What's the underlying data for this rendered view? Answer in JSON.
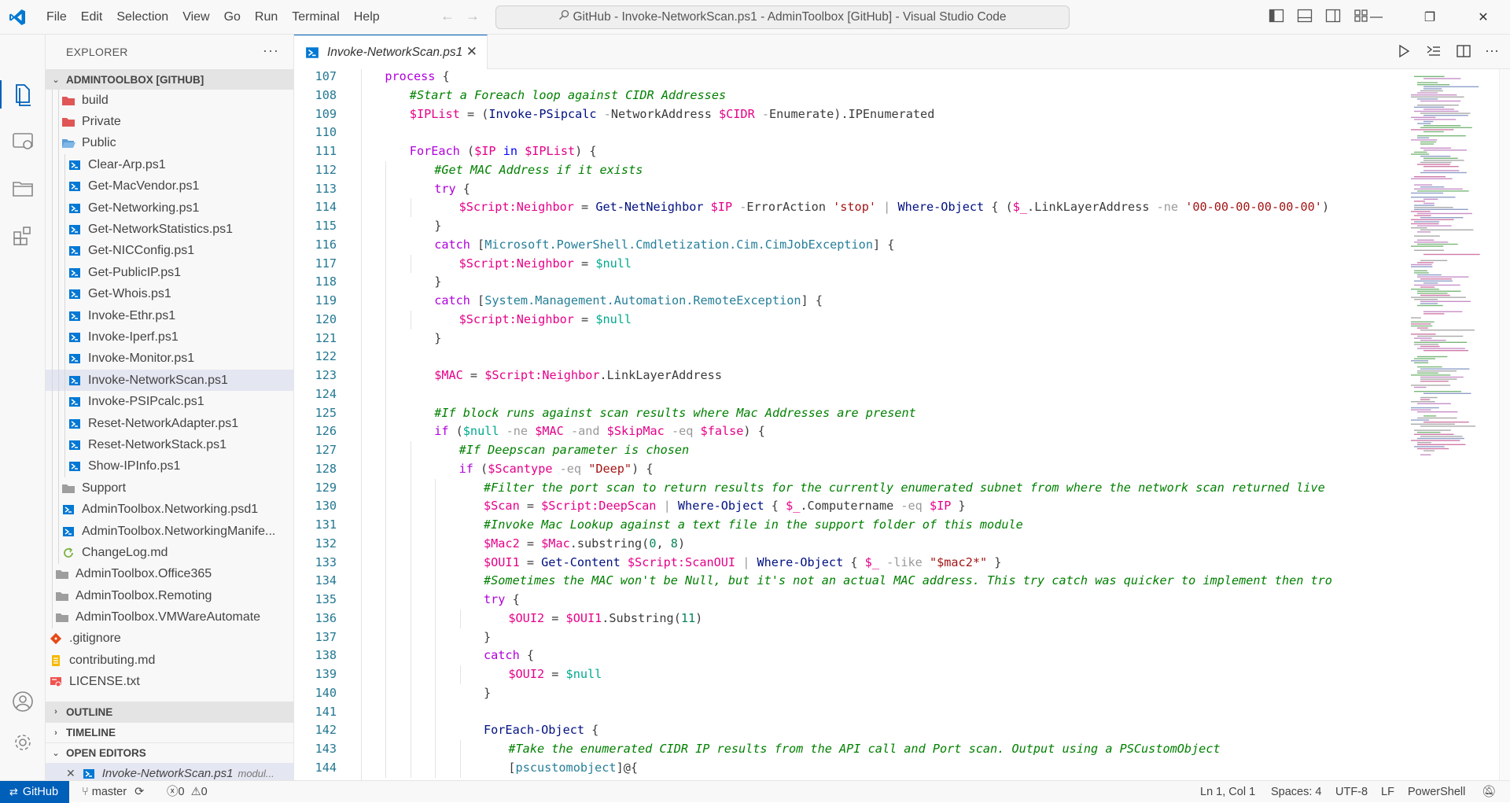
{
  "window": {
    "title": "GitHub - Invoke-NetworkScan.ps1 - AdminToolbox [GitHub] - Visual Studio Code",
    "menu": [
      "File",
      "Edit",
      "Selection",
      "View",
      "Go",
      "Run",
      "Terminal",
      "Help"
    ]
  },
  "sidebar": {
    "header": "EXPLORER",
    "root": "ADMINTOOLBOX [GITHUB]",
    "tree": [
      {
        "label": "build",
        "kind": "folder-red",
        "depth": 3
      },
      {
        "label": "Private",
        "kind": "folder-red",
        "depth": 3
      },
      {
        "label": "Public",
        "kind": "folder-open-blue",
        "depth": 3
      },
      {
        "label": "Clear-Arp.ps1",
        "kind": "ps1",
        "depth": 4
      },
      {
        "label": "Get-MacVendor.ps1",
        "kind": "ps1",
        "depth": 4
      },
      {
        "label": "Get-Networking.ps1",
        "kind": "ps1",
        "depth": 4
      },
      {
        "label": "Get-NetworkStatistics.ps1",
        "kind": "ps1",
        "depth": 4
      },
      {
        "label": "Get-NICConfig.ps1",
        "kind": "ps1",
        "depth": 4
      },
      {
        "label": "Get-PublicIP.ps1",
        "kind": "ps1",
        "depth": 4
      },
      {
        "label": "Get-Whois.ps1",
        "kind": "ps1",
        "depth": 4
      },
      {
        "label": "Invoke-Ethr.ps1",
        "kind": "ps1",
        "depth": 4
      },
      {
        "label": "Invoke-Iperf.ps1",
        "kind": "ps1",
        "depth": 4
      },
      {
        "label": "Invoke-Monitor.ps1",
        "kind": "ps1",
        "depth": 4
      },
      {
        "label": "Invoke-NetworkScan.ps1",
        "kind": "ps1",
        "depth": 4,
        "selected": true
      },
      {
        "label": "Invoke-PSIPcalc.ps1",
        "kind": "ps1",
        "depth": 4
      },
      {
        "label": "Reset-NetworkAdapter.ps1",
        "kind": "ps1",
        "depth": 4
      },
      {
        "label": "Reset-NetworkStack.ps1",
        "kind": "ps1",
        "depth": 4
      },
      {
        "label": "Show-IPInfo.ps1",
        "kind": "ps1",
        "depth": 4
      },
      {
        "label": "Support",
        "kind": "folder-gray",
        "depth": 3
      },
      {
        "label": "AdminToolbox.Networking.psd1",
        "kind": "ps1",
        "depth": 3
      },
      {
        "label": "AdminToolbox.NetworkingManife...",
        "kind": "ps1",
        "depth": 3
      },
      {
        "label": "ChangeLog.md",
        "kind": "md-loop",
        "depth": 3
      },
      {
        "label": "AdminToolbox.Office365",
        "kind": "folder-gray",
        "depth": 2
      },
      {
        "label": "AdminToolbox.Remoting",
        "kind": "folder-gray",
        "depth": 2
      },
      {
        "label": "AdminToolbox.VMWareAutomate",
        "kind": "folder-gray",
        "depth": 2
      },
      {
        "label": ".gitignore",
        "kind": "git",
        "depth": 1
      },
      {
        "label": "contributing.md",
        "kind": "md",
        "depth": 1
      },
      {
        "label": "LICENSE.txt",
        "kind": "license",
        "depth": 1
      }
    ],
    "sections": {
      "outline": "OUTLINE",
      "timeline": "TIMELINE",
      "open_editors": "OPEN EDITORS"
    },
    "open_editor": {
      "name": "Invoke-NetworkScan.ps1",
      "path": "modul..."
    }
  },
  "tab": {
    "label": "Invoke-NetworkScan.ps1"
  },
  "editor": {
    "lines": [
      {
        "n": "107",
        "i": 1,
        "t": [
          [
            "kw",
            "process"
          ],
          [
            "pr",
            " {"
          ]
        ]
      },
      {
        "n": "108",
        "i": 2,
        "t": [
          [
            "cm",
            "#Start a Foreach loop against CIDR Addresses"
          ]
        ]
      },
      {
        "n": "109",
        "i": 2,
        "t": [
          [
            "var",
            "$IPList"
          ],
          [
            "pr",
            " = ("
          ],
          [
            "fn",
            "Invoke-PSipcalc"
          ],
          [
            "op",
            " -"
          ],
          [
            "pr",
            "NetworkAddress "
          ],
          [
            "var",
            "$CIDR"
          ],
          [
            "op",
            " -"
          ],
          [
            "pr",
            "Enumerate)."
          ],
          [
            "pr",
            "IPEnumerated"
          ]
        ]
      },
      {
        "n": "110",
        "i": 0,
        "t": []
      },
      {
        "n": "111",
        "i": 2,
        "t": [
          [
            "kw",
            "ForEach"
          ],
          [
            "pr",
            " ("
          ],
          [
            "var",
            "$IP"
          ],
          [
            "kw2",
            " in "
          ],
          [
            "var",
            "$IPList"
          ],
          [
            "pr",
            ") {"
          ]
        ]
      },
      {
        "n": "112",
        "i": 3,
        "t": [
          [
            "cm",
            "#Get MAC Address if it exists"
          ]
        ]
      },
      {
        "n": "113",
        "i": 3,
        "t": [
          [
            "kw",
            "try"
          ],
          [
            "pr",
            " {"
          ]
        ]
      },
      {
        "n": "114",
        "i": 4,
        "t": [
          [
            "var",
            "$Script:Neighbor"
          ],
          [
            "pr",
            " = "
          ],
          [
            "fn",
            "Get-NetNeighbor"
          ],
          [
            "pr",
            " "
          ],
          [
            "var",
            "$IP"
          ],
          [
            "op",
            " -"
          ],
          [
            "pr",
            "ErrorAction "
          ],
          [
            "str",
            "'stop'"
          ],
          [
            "op",
            " | "
          ],
          [
            "fn",
            "Where-Object"
          ],
          [
            "pr",
            " { ("
          ],
          [
            "var",
            "$_"
          ],
          [
            "pr",
            ".LinkLayerAddress "
          ],
          [
            "op",
            "-ne "
          ],
          [
            "str",
            "'00-00-00-00-00-00'"
          ],
          [
            "pr",
            ")"
          ]
        ]
      },
      {
        "n": "115",
        "i": 3,
        "t": [
          [
            "pr",
            "}"
          ]
        ]
      },
      {
        "n": "116",
        "i": 3,
        "t": [
          [
            "kw",
            "catch"
          ],
          [
            "pr",
            " ["
          ],
          [
            "type",
            "Microsoft.PowerShell.Cmdletization.Cim.CimJobException"
          ],
          [
            "pr",
            "] {"
          ]
        ]
      },
      {
        "n": "117",
        "i": 4,
        "t": [
          [
            "var",
            "$Script:Neighbor"
          ],
          [
            "pr",
            " = "
          ],
          [
            "nul",
            "$null"
          ]
        ]
      },
      {
        "n": "118",
        "i": 3,
        "t": [
          [
            "pr",
            "}"
          ]
        ]
      },
      {
        "n": "119",
        "i": 3,
        "t": [
          [
            "kw",
            "catch"
          ],
          [
            "pr",
            " ["
          ],
          [
            "type",
            "System.Management.Automation.RemoteException"
          ],
          [
            "pr",
            "] {"
          ]
        ]
      },
      {
        "n": "120",
        "i": 4,
        "t": [
          [
            "var",
            "$Script:Neighbor"
          ],
          [
            "pr",
            " = "
          ],
          [
            "nul",
            "$null"
          ]
        ]
      },
      {
        "n": "121",
        "i": 3,
        "t": [
          [
            "pr",
            "}"
          ]
        ]
      },
      {
        "n": "122",
        "i": 0,
        "t": []
      },
      {
        "n": "123",
        "i": 3,
        "t": [
          [
            "var",
            "$MAC"
          ],
          [
            "pr",
            " = "
          ],
          [
            "var",
            "$Script:Neighbor"
          ],
          [
            "pr",
            ".LinkLayerAddress"
          ]
        ]
      },
      {
        "n": "124",
        "i": 0,
        "t": []
      },
      {
        "n": "125",
        "i": 3,
        "t": [
          [
            "cm",
            "#If block runs against scan results where Mac Addresses are present"
          ]
        ]
      },
      {
        "n": "126",
        "i": 3,
        "t": [
          [
            "kw",
            "if"
          ],
          [
            "pr",
            " ("
          ],
          [
            "nul",
            "$null"
          ],
          [
            "op",
            " -ne "
          ],
          [
            "var",
            "$MAC"
          ],
          [
            "op",
            " -and "
          ],
          [
            "var",
            "$SkipMac"
          ],
          [
            "op",
            " -eq "
          ],
          [
            "var",
            "$false"
          ],
          [
            "pr",
            ") {"
          ]
        ]
      },
      {
        "n": "127",
        "i": 4,
        "t": [
          [
            "cm",
            "#If Deepscan parameter is chosen"
          ]
        ]
      },
      {
        "n": "128",
        "i": 4,
        "t": [
          [
            "kw",
            "if"
          ],
          [
            "pr",
            " ("
          ],
          [
            "var",
            "$Scantype"
          ],
          [
            "op",
            " -eq "
          ],
          [
            "str",
            "\"Deep\""
          ],
          [
            "pr",
            ") {"
          ]
        ]
      },
      {
        "n": "129",
        "i": 5,
        "t": [
          [
            "cm",
            "#Filter the port scan to return results for the currently enumerated subnet from where the network scan returned live"
          ]
        ]
      },
      {
        "n": "130",
        "i": 5,
        "t": [
          [
            "var",
            "$Scan"
          ],
          [
            "pr",
            " = "
          ],
          [
            "var",
            "$Script:DeepScan"
          ],
          [
            "op",
            " | "
          ],
          [
            "fn",
            "Where-Object"
          ],
          [
            "pr",
            " { "
          ],
          [
            "var",
            "$_"
          ],
          [
            "pr",
            ".Computername "
          ],
          [
            "op",
            "-eq "
          ],
          [
            "var",
            "$IP"
          ],
          [
            "pr",
            " }"
          ]
        ]
      },
      {
        "n": "131",
        "i": 5,
        "t": [
          [
            "cm",
            "#Invoke Mac Lookup against a text file in the support folder of this module"
          ]
        ]
      },
      {
        "n": "132",
        "i": 5,
        "t": [
          [
            "var",
            "$Mac2"
          ],
          [
            "pr",
            " = "
          ],
          [
            "var",
            "$Mac"
          ],
          [
            "pr",
            ".substring("
          ],
          [
            "num",
            "0"
          ],
          [
            "pr",
            ", "
          ],
          [
            "num",
            "8"
          ],
          [
            "pr",
            ")"
          ]
        ]
      },
      {
        "n": "133",
        "i": 5,
        "t": [
          [
            "var",
            "$OUI1"
          ],
          [
            "pr",
            " = "
          ],
          [
            "fn",
            "Get-Content"
          ],
          [
            "pr",
            " "
          ],
          [
            "var",
            "$Script:ScanOUI"
          ],
          [
            "op",
            " | "
          ],
          [
            "fn",
            "Where-Object"
          ],
          [
            "pr",
            " { "
          ],
          [
            "var",
            "$_"
          ],
          [
            "op",
            " -like "
          ],
          [
            "str",
            "\"$mac2*\""
          ],
          [
            "pr",
            " }"
          ]
        ]
      },
      {
        "n": "134",
        "i": 5,
        "t": [
          [
            "cm",
            "#Sometimes the MAC won't be Null, but it's not an actual MAC address. This try catch was quicker to implement then tro"
          ]
        ]
      },
      {
        "n": "135",
        "i": 5,
        "t": [
          [
            "kw",
            "try"
          ],
          [
            "pr",
            " {"
          ]
        ]
      },
      {
        "n": "136",
        "i": 6,
        "t": [
          [
            "var",
            "$OUI2"
          ],
          [
            "pr",
            " = "
          ],
          [
            "var",
            "$OUI1"
          ],
          [
            "pr",
            ".Substring("
          ],
          [
            "num",
            "11"
          ],
          [
            "pr",
            ")"
          ]
        ]
      },
      {
        "n": "137",
        "i": 5,
        "t": [
          [
            "pr",
            "}"
          ]
        ]
      },
      {
        "n": "138",
        "i": 5,
        "t": [
          [
            "kw",
            "catch"
          ],
          [
            "pr",
            " {"
          ]
        ]
      },
      {
        "n": "139",
        "i": 6,
        "t": [
          [
            "var",
            "$OUI2"
          ],
          [
            "pr",
            " = "
          ],
          [
            "nul",
            "$null"
          ]
        ]
      },
      {
        "n": "140",
        "i": 5,
        "t": [
          [
            "pr",
            "}"
          ]
        ]
      },
      {
        "n": "141",
        "i": 0,
        "t": []
      },
      {
        "n": "142",
        "i": 5,
        "t": [
          [
            "fn",
            "ForEach-Object"
          ],
          [
            "pr",
            " {"
          ]
        ]
      },
      {
        "n": "143",
        "i": 6,
        "t": [
          [
            "cm",
            "#Take the enumerated CIDR IP results from the API call and Port scan. Output using a PSCustomObject"
          ]
        ]
      },
      {
        "n": "144",
        "i": 6,
        "t": [
          [
            "pr",
            "["
          ],
          [
            "type",
            "pscustomobject"
          ],
          [
            "pr",
            "]@{"
          ]
        ]
      }
    ]
  },
  "statusbar": {
    "remote": "GitHub",
    "branch": "master",
    "problems_errors": "0",
    "problems_warnings": "0",
    "cursor": "Ln 1, Col 1",
    "spaces": "Spaces: 4",
    "encoding": "UTF-8",
    "eol": "LF",
    "language": "PowerShell"
  },
  "colors": {
    "accent": "#005fb8",
    "ps_icon": "#0078d4",
    "folder_red": "#e05656",
    "folder_gray": "#9e9e9e"
  }
}
